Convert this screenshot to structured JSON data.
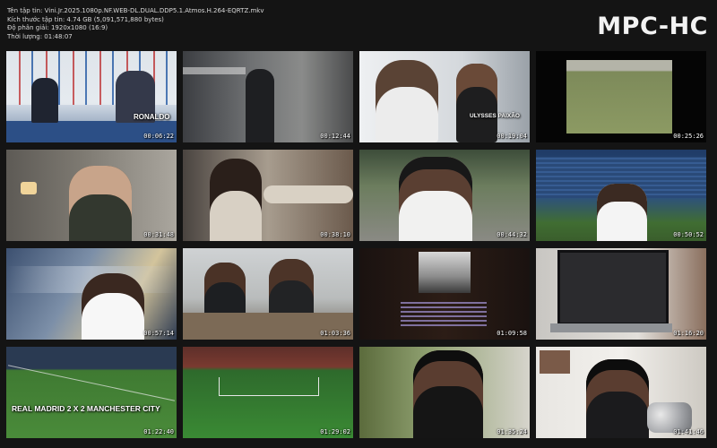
{
  "info": {
    "filename": "Tên tập tin: Vini.Jr.2025.1080p.NF.WEB-DL.DUAL.DDP5.1.Atmos.H.264-EQRTZ.mkv",
    "filesize": "Kích thước tập tin: 4.74 GB (5,091,571,880 bytes)",
    "resolution": "Độ phân giải: 1920x1080 (16:9)",
    "duration": "Thời lượng: 01:48:07"
  },
  "logo": "MPC-HC",
  "thumbs": [
    {
      "time": "00:06:22",
      "caption": "RONALDO"
    },
    {
      "time": "00:12:44"
    },
    {
      "time": "00:19:04",
      "caption": "ULYSSES PAIXÃO"
    },
    {
      "time": "00:25:26"
    },
    {
      "time": "00:31:48"
    },
    {
      "time": "00:38:10"
    },
    {
      "time": "00:44:32"
    },
    {
      "time": "00:50:52"
    },
    {
      "time": "00:57:14"
    },
    {
      "time": "01:03:36"
    },
    {
      "time": "01:09:58"
    },
    {
      "time": "01:16:20"
    },
    {
      "time": "01:22:40",
      "caption": "REAL MADRID 2 X 2 MANCHESTER CITY"
    },
    {
      "time": "01:29:02"
    },
    {
      "time": "01:35:24"
    },
    {
      "time": "01:41:46"
    }
  ]
}
